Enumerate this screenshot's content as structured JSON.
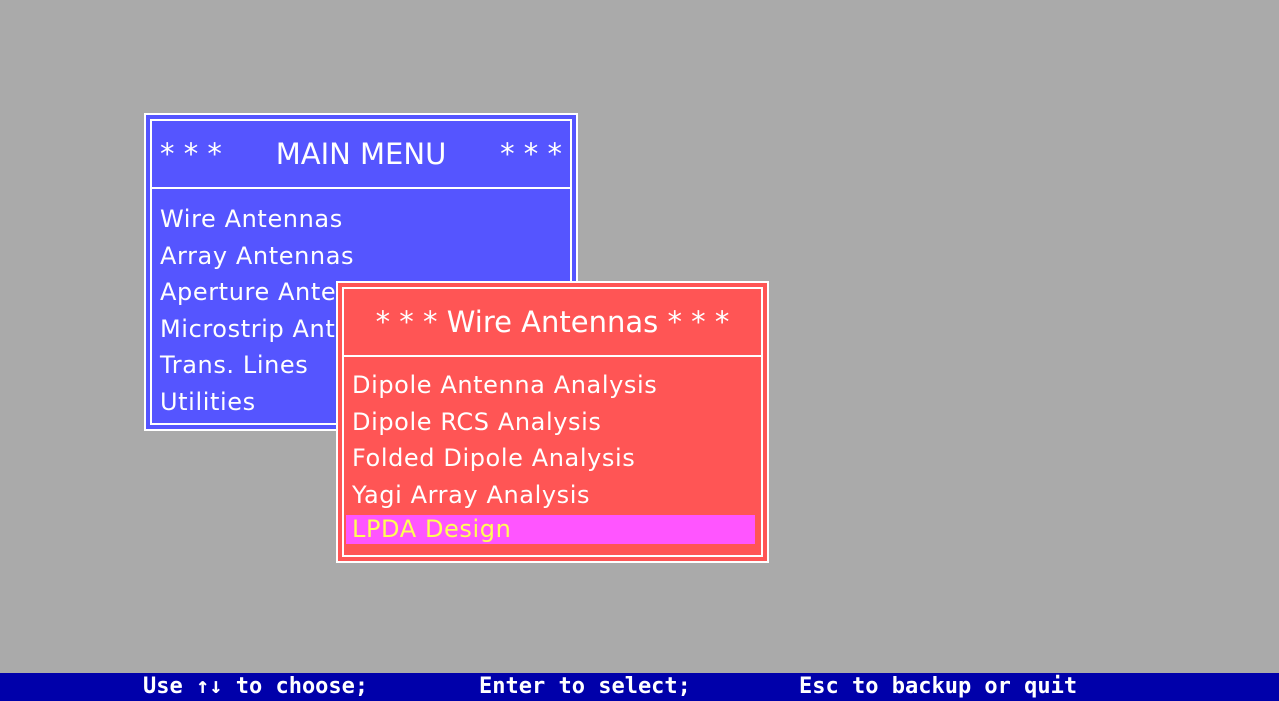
{
  "main_menu": {
    "title_prefix": "* * *",
    "title": "MAIN MENU",
    "title_suffix": "* * *",
    "items": [
      {
        "label": "Wire Antennas"
      },
      {
        "label": "Array Antennas"
      },
      {
        "label": "Aperture Antennas"
      },
      {
        "label": "Microstrip Antennas"
      },
      {
        "label": "Trans. Lines"
      },
      {
        "label": "Utilities"
      }
    ]
  },
  "wire_menu": {
    "title": "* * * Wire Antennas * * *",
    "items": [
      {
        "label": "Dipole Antenna Analysis"
      },
      {
        "label": "Dipole RCS Analysis"
      },
      {
        "label": "Folded Dipole Analysis"
      },
      {
        "label": "Yagi Array Analysis"
      },
      {
        "label": "LPDA  Design",
        "selected": true
      }
    ]
  },
  "status_bar": {
    "choose": "Use ↑↓ to choose;",
    "select": "Enter to select;",
    "quit": "Esc to backup or quit"
  },
  "colors": {
    "desktop": "#aaaaaa",
    "main_menu_bg": "#5555ff",
    "wire_menu_bg": "#ff5555",
    "selected_bg": "#ff55ff",
    "selected_text": "#ffff55",
    "status_bg": "#0000aa"
  }
}
